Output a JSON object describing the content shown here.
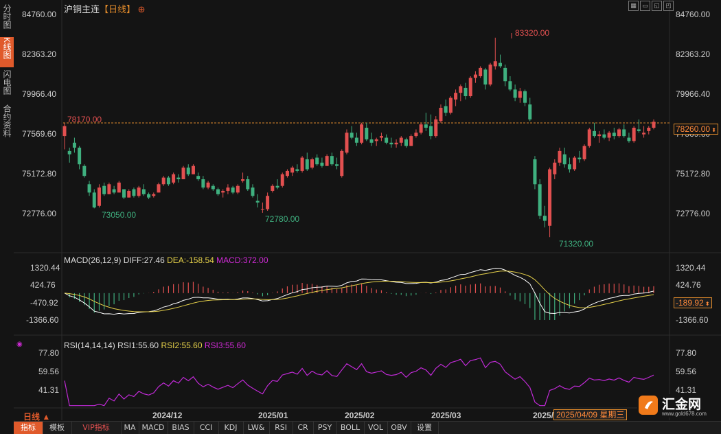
{
  "sidebar": {
    "tabs": [
      {
        "label": "分时图",
        "active": false
      },
      {
        "label": "K线图",
        "active": true
      },
      {
        "label": "闪电图",
        "active": false
      },
      {
        "label": "合约资料",
        "active": false
      }
    ]
  },
  "header": {
    "symbol": "沪铜主连",
    "period": "【日线】",
    "add_icon": "plus-circle-icon",
    "window_icons": [
      "grid-icon",
      "minus-icon",
      "restore-icon",
      "maximize-icon"
    ]
  },
  "price_axis": {
    "ticks": [
      "84760.00",
      "82363.20",
      "79966.40",
      "77569.60",
      "75172.80",
      "72776.00"
    ],
    "current_price": "78260.00",
    "reference_price": "78170.00"
  },
  "annotations": {
    "high": "83320.00",
    "low_1": "73050.00",
    "low_2": "72780.00",
    "low_3": "71320.00"
  },
  "macd": {
    "title": "MACD(26,12,9)",
    "diff": "DIFF:27.46",
    "dea": "DEA:-158.54",
    "macd": "MACD:372.00",
    "ticks": [
      "1320.44",
      "424.76",
      "-470.92",
      "-1366.60"
    ],
    "current": "-189.92"
  },
  "rsi": {
    "title": "RSI(14,14,14)",
    "rsi1": "RSI1:55.60",
    "rsi2": "RSI2:55.60",
    "rsi3": "RSI3:55.60",
    "ticks": [
      "77.80",
      "59.56",
      "41.31"
    ]
  },
  "time_axis": {
    "period_label": "日线 ▲",
    "labels": [
      "2024/12",
      "2025/01",
      "2025/02",
      "2025/03",
      "2025/"
    ],
    "cursor_date": "2025/04/09 星期三"
  },
  "bottom_tabs": [
    "指标",
    "模板",
    "VIP指标",
    "MA",
    "MACD",
    "BIAS",
    "CCI",
    "KDJ",
    "LW&",
    "RSI",
    "CR",
    "PSY",
    "BOLL",
    "VOL",
    "OBV",
    "设置"
  ],
  "logo": {
    "name": "汇金网",
    "url_text": "www.gold678.com"
  },
  "colors": {
    "up": "#e25050",
    "down": "#3fb07f",
    "diff": "#ffffff",
    "dea": "#e6d14a",
    "rsi": "#c02ad6",
    "accent": "#e05a2b"
  },
  "chart_data": [
    {
      "type": "candlestick",
      "title": "沪铜主连【日线】",
      "ylim": [
        71320,
        84760
      ],
      "y_ticks": [
        84760.0,
        82363.2,
        79966.4,
        77569.6,
        75172.8,
        72776.0
      ],
      "x_labels": [
        "2024/12",
        "2025/01",
        "2025/02",
        "2025/03",
        "2025/04"
      ],
      "markers": {
        "high": 83320,
        "lows": [
          73050,
          72780,
          71320
        ],
        "reference": 78170,
        "last": 78260
      },
      "ohlc": [
        [
          77400,
          78170,
          76600,
          78000
        ],
        [
          76500,
          76700,
          75800,
          76300
        ],
        [
          77000,
          77300,
          76400,
          76700
        ],
        [
          76700,
          76800,
          75400,
          75700
        ],
        [
          75600,
          75700,
          74900,
          75000
        ],
        [
          74500,
          74700,
          73800,
          74000
        ],
        [
          74000,
          74200,
          73050,
          73100
        ],
        [
          73200,
          74500,
          73100,
          74300
        ],
        [
          74400,
          74600,
          73800,
          73900
        ],
        [
          73900,
          74600,
          73900,
          74500
        ],
        [
          74200,
          74400,
          73900,
          74000
        ],
        [
          74000,
          74700,
          74000,
          74600
        ],
        [
          74200,
          74200,
          73600,
          73700
        ],
        [
          73700,
          74200,
          73700,
          74100
        ],
        [
          74200,
          74300,
          73700,
          73800
        ],
        [
          73800,
          74400,
          73700,
          74300
        ],
        [
          74200,
          74500,
          73800,
          73900
        ],
        [
          73900,
          74000,
          73600,
          73700
        ],
        [
          73800,
          74000,
          73700,
          73900
        ],
        [
          74000,
          74600,
          74000,
          74500
        ],
        [
          74500,
          75000,
          74400,
          74900
        ],
        [
          74900,
          75000,
          74400,
          74500
        ],
        [
          74600,
          75200,
          74500,
          75100
        ],
        [
          74900,
          75100,
          74600,
          74800
        ],
        [
          74800,
          75600,
          74800,
          75500
        ],
        [
          75500,
          75700,
          75000,
          75100
        ],
        [
          75100,
          75700,
          75100,
          75600
        ],
        [
          75000,
          75200,
          74700,
          74800
        ],
        [
          74800,
          75000,
          74200,
          74300
        ],
        [
          74300,
          74700,
          74200,
          74600
        ],
        [
          74400,
          74500,
          74100,
          74200
        ],
        [
          74200,
          74300,
          73800,
          73900
        ],
        [
          74000,
          74200,
          73700,
          74100
        ],
        [
          74100,
          74500,
          73900,
          74300
        ],
        [
          74300,
          74400,
          73900,
          74000
        ],
        [
          74000,
          74500,
          73900,
          74400
        ],
        [
          74700,
          75200,
          74600,
          74800
        ],
        [
          74800,
          75000,
          74100,
          74200
        ],
        [
          74300,
          74500,
          73700,
          73800
        ],
        [
          73500,
          73900,
          73100,
          73400
        ],
        [
          73000,
          73400,
          72780,
          73000
        ],
        [
          73000,
          74000,
          72900,
          73800
        ],
        [
          74100,
          74500,
          74000,
          74400
        ],
        [
          74400,
          74800,
          74200,
          74300
        ],
        [
          74400,
          75200,
          74300,
          75100
        ],
        [
          75000,
          75400,
          74900,
          75300
        ],
        [
          75200,
          75600,
          75000,
          75500
        ],
        [
          75400,
          75700,
          75200,
          75300
        ],
        [
          75300,
          76200,
          75200,
          76100
        ],
        [
          76000,
          76400,
          75300,
          75400
        ],
        [
          75500,
          76100,
          75400,
          76000
        ],
        [
          76100,
          76300,
          75600,
          75700
        ],
        [
          75800,
          76100,
          75500,
          75600
        ],
        [
          75600,
          76300,
          75600,
          76200
        ],
        [
          76200,
          76400,
          75600,
          75700
        ],
        [
          75700,
          76100,
          75400,
          75600
        ],
        [
          75000,
          76600,
          74900,
          76500
        ],
        [
          76400,
          77800,
          76300,
          77600
        ],
        [
          77600,
          78000,
          77200,
          77300
        ],
        [
          77300,
          77600,
          76800,
          77000
        ],
        [
          77000,
          78200,
          76900,
          78100
        ],
        [
          77900,
          78200,
          77100,
          77200
        ],
        [
          77200,
          77600,
          76800,
          77000
        ],
        [
          77100,
          77300,
          76800,
          77200
        ],
        [
          77300,
          77600,
          77100,
          77400
        ],
        [
          77300,
          77500,
          76900,
          77000
        ],
        [
          77000,
          77300,
          76700,
          76900
        ],
        [
          76900,
          77200,
          76700,
          77000
        ],
        [
          77000,
          77400,
          76800,
          77300
        ],
        [
          77200,
          77300,
          76700,
          76800
        ],
        [
          76800,
          77500,
          76800,
          77400
        ],
        [
          77400,
          77800,
          77300,
          77600
        ],
        [
          77600,
          78200,
          77500,
          78100
        ],
        [
          78100,
          78800,
          77700,
          77900
        ],
        [
          78000,
          78700,
          77200,
          77400
        ],
        [
          77400,
          78600,
          77300,
          78400
        ],
        [
          78300,
          79300,
          78200,
          79100
        ],
        [
          79200,
          79600,
          78600,
          78800
        ],
        [
          78800,
          79800,
          78700,
          79700
        ],
        [
          79600,
          80200,
          79200,
          80000
        ],
        [
          80000,
          80500,
          79500,
          80400
        ],
        [
          80300,
          80600,
          79600,
          79800
        ],
        [
          79800,
          81000,
          79700,
          80900
        ],
        [
          80900,
          81300,
          80600,
          81100
        ],
        [
          81000,
          81600,
          80900,
          81500
        ],
        [
          81400,
          81500,
          80200,
          80500
        ],
        [
          80500,
          81800,
          80400,
          81700
        ],
        [
          81600,
          83320,
          81400,
          81900
        ],
        [
          81800,
          82300,
          81500,
          81600
        ],
        [
          81500,
          81700,
          80400,
          80700
        ],
        [
          80700,
          81000,
          80100,
          80200
        ],
        [
          80200,
          80500,
          79500,
          79700
        ],
        [
          79700,
          80300,
          79400,
          80100
        ],
        [
          80100,
          80200,
          79200,
          79400
        ],
        [
          79300,
          79700,
          78300,
          78400
        ],
        [
          76000,
          76200,
          74200,
          74500
        ],
        [
          74500,
          74800,
          72400,
          72600
        ],
        [
          72600,
          73200,
          71900,
          72300
        ],
        [
          72000,
          75500,
          71320,
          75400
        ],
        [
          75100,
          76000,
          74800,
          75800
        ],
        [
          75800,
          76700,
          75600,
          76500
        ],
        [
          76300,
          76700,
          75500,
          75700
        ],
        [
          75700,
          76100,
          75200,
          75400
        ],
        [
          75400,
          76200,
          75300,
          76100
        ],
        [
          76100,
          76500,
          75800,
          76000
        ],
        [
          76000,
          76900,
          75900,
          76800
        ],
        [
          76800,
          77900,
          76700,
          77800
        ],
        [
          77700,
          78200,
          77300,
          77400
        ],
        [
          77400,
          77700,
          77000,
          77500
        ],
        [
          77500,
          77800,
          77200,
          77300
        ],
        [
          77300,
          77700,
          77100,
          77600
        ],
        [
          77600,
          77900,
          77200,
          77400
        ],
        [
          77400,
          77900,
          77300,
          77800
        ],
        [
          77800,
          78100,
          77300,
          77400
        ],
        [
          77300,
          77600,
          77000,
          77100
        ],
        [
          77100,
          78000,
          77000,
          77900
        ],
        [
          77800,
          78400,
          77600,
          77700
        ],
        [
          77500,
          78000,
          77300,
          77600
        ],
        [
          77700,
          78000,
          77500,
          77900
        ],
        [
          77900,
          78400,
          77800,
          78260
        ]
      ]
    },
    {
      "type": "line+bar",
      "title": "MACD(26,12,9)",
      "ylim": [
        -1366.6,
        1320.44
      ],
      "series": [
        {
          "name": "DIFF",
          "last": 27.46
        },
        {
          "name": "DEA",
          "last": -158.54
        },
        {
          "name": "MACD",
          "last": 372.0
        }
      ]
    },
    {
      "type": "line",
      "title": "RSI(14,14,14)",
      "ylim": [
        41.31,
        77.8
      ],
      "series": [
        {
          "name": "RSI1",
          "last": 55.6
        },
        {
          "name": "RSI2",
          "last": 55.6
        },
        {
          "name": "RSI3",
          "last": 55.6
        }
      ]
    }
  ]
}
